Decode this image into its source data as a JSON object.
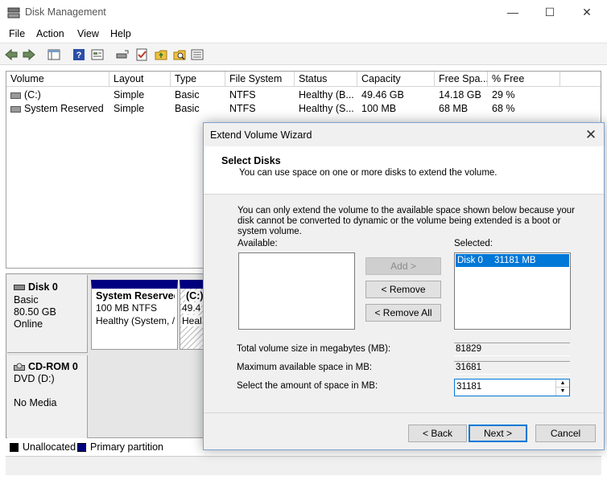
{
  "window": {
    "title": "Disk Management",
    "controls": {
      "minimize": "—",
      "maximize": "☐",
      "close": "✕"
    }
  },
  "menu": [
    "File",
    "Action",
    "View",
    "Help"
  ],
  "volume_table": {
    "columns": [
      "Volume",
      "Layout",
      "Type",
      "File System",
      "Status",
      "Capacity",
      "Free Spa...",
      "% Free"
    ],
    "rows": [
      [
        "(C:)",
        "Simple",
        "Basic",
        "NTFS",
        "Healthy (B...",
        "49.46 GB",
        "14.18 GB",
        "29 %"
      ],
      [
        "System Reserved",
        "Simple",
        "Basic",
        "NTFS",
        "Healthy (S...",
        "100 MB",
        "68 MB",
        "68 %"
      ]
    ]
  },
  "disks": {
    "disk0": {
      "name": "Disk 0",
      "type": "Basic",
      "size": "80.50 GB",
      "status": "Online",
      "partitions": [
        {
          "name": "System Reserved",
          "size": "100 MB NTFS",
          "status": "Healthy (System, /"
        },
        {
          "name": "(C:)",
          "size": "49.4",
          "status": "Heal"
        }
      ]
    },
    "cdrom0": {
      "name": "CD-ROM 0",
      "type": "DVD (D:)",
      "status": "No Media"
    }
  },
  "legend": {
    "unallocated": "Unallocated",
    "primary": "Primary partition",
    "colors": {
      "unallocated": "#000000",
      "primary": "#000080"
    }
  },
  "dialog": {
    "title": "Extend Volume Wizard",
    "heading": "Select Disks",
    "subheading": "You can use space on one or more disks to extend the volume.",
    "info": "You can only extend the volume to the available space shown below because your disk cannot be converted to dynamic or the volume being extended is a boot or system volume.",
    "available_label": "Available:",
    "selected_label": "Selected:",
    "selected_items": [
      {
        "disk": "Disk 0",
        "size": "31181 MB"
      }
    ],
    "add_button": "Add >",
    "remove_button": "< Remove",
    "remove_all_button": "< Remove All",
    "total_label": "Total volume size in megabytes (MB):",
    "total_value": "81829",
    "max_label": "Maximum available space in MB:",
    "max_value": "31681",
    "amount_label": "Select the amount of space in MB:",
    "amount_value": "31181",
    "back_button": "< Back",
    "next_button": "Next >",
    "cancel_button": "Cancel",
    "accent_color": "#0078d7"
  }
}
